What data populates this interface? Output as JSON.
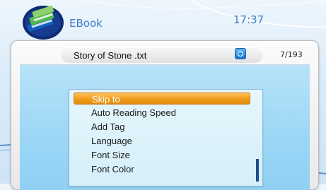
{
  "header": {
    "app_name": "EBook",
    "clock": "17:37"
  },
  "window": {
    "title": "Story of Stone .txt",
    "page_indicator": "7/193",
    "status_icon": "lock-icon"
  },
  "menu": {
    "items": [
      {
        "label": "Skip to",
        "selected": true
      },
      {
        "label": "Auto Reading  Speed",
        "selected": false
      },
      {
        "label": "Add Tag",
        "selected": false
      },
      {
        "label": "Language",
        "selected": false
      },
      {
        "label": "Font Size",
        "selected": false
      },
      {
        "label": "Font Color",
        "selected": false
      }
    ],
    "scroll_position": 0.75
  },
  "colors": {
    "accent": "#3d7ec5",
    "selection": "#ef9a18",
    "content_bg": "#9dd7f6"
  }
}
